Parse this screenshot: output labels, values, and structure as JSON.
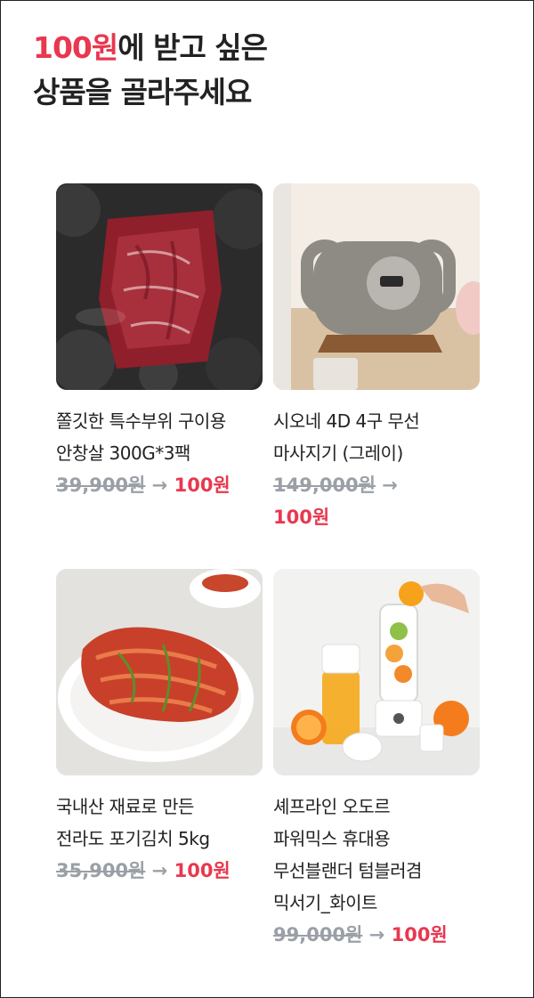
{
  "headline": {
    "accent": "100원",
    "line1_rest": "에 받고 싶은",
    "line2": "상품을 골라주세요"
  },
  "arrow_glyph": "→",
  "colors": {
    "accent": "#e8384f",
    "strikethrough_price": "#9aa0a6",
    "text": "#222222"
  },
  "products": [
    {
      "name_line1": "쫄깃한 특수부위 구이용",
      "name_line2": "안창살 300G*3팩",
      "original_price": "39,900원",
      "sale_price": "100원",
      "image": "marinated-beef-on-charcoal"
    },
    {
      "name_line1": "시오네 4D 4구 무선",
      "name_line2": "마사지기 (그레이)",
      "original_price": "149,000원",
      "sale_price": "100원",
      "image": "gray-handheld-massager"
    },
    {
      "name_line1": "국내산 재료로 만든",
      "name_line2": "전라도 포기김치 5kg",
      "original_price": "35,900원",
      "sale_price": "100원",
      "image": "kimchi-on-plate"
    },
    {
      "name_line1": "셰프라인 오도르",
      "name_line2": "파워믹스 휴대용",
      "name_line3": "무선블랜더 텀블러겸",
      "name_line4": "믹서기_화이트",
      "original_price": "99,000원",
      "sale_price": "100원",
      "image": "portable-blender-with-fruit"
    }
  ]
}
